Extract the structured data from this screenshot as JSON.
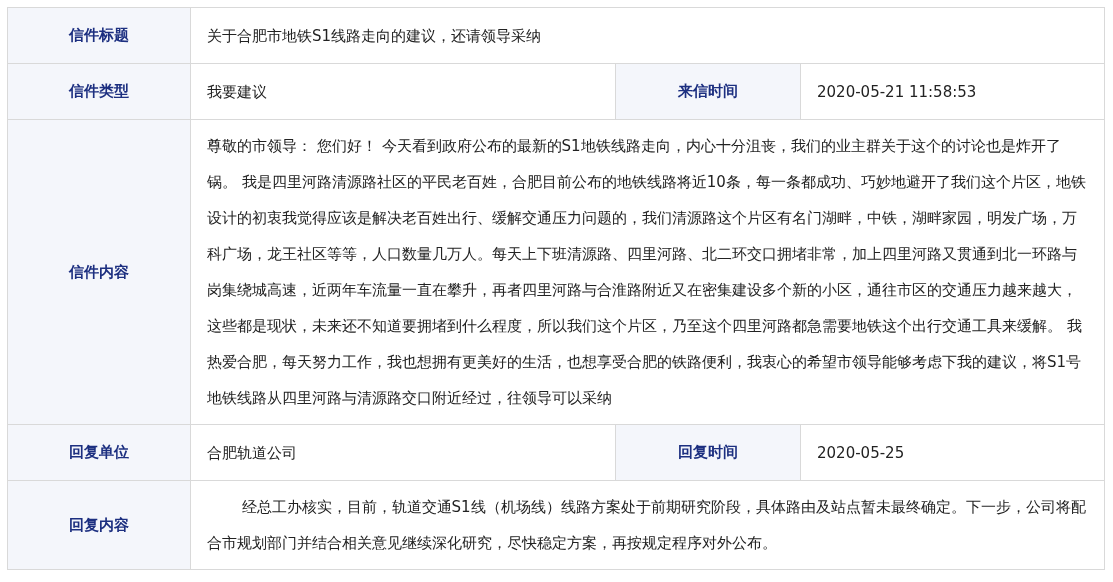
{
  "rows": [
    {
      "cells": [
        {
          "kind": "label",
          "text": "信件标题"
        },
        {
          "kind": "value",
          "text": "关于合肥市地铁S1线路走向的建议，还请领导采纳"
        }
      ]
    },
    {
      "cells": [
        {
          "kind": "label",
          "text": "信件类型"
        },
        {
          "kind": "value",
          "text": "我要建议"
        },
        {
          "kind": "label",
          "text": "来信时间"
        },
        {
          "kind": "value",
          "text": "2020-05-21 11:58:53"
        }
      ]
    },
    {
      "cells": [
        {
          "kind": "label",
          "text": "信件内容"
        },
        {
          "kind": "value",
          "text": "尊敬的市领导： 您们好！ 今天看到政府公布的最新的S1地铁线路走向，内心十分沮丧，我们的业主群关于这个的讨论也是炸开了锅。 我是四里河路清源路社区的平民老百姓，合肥目前公布的地铁线路将近10条，每一条都成功、巧妙地避开了我们这个片区，地铁设计的初衷我觉得应该是解决老百姓出行、缓解交通压力问题的，我们清源路这个片区有名门湖畔，中铁，湖畔家园，明发广场，万科广场，龙王社区等等，人口数量几万人。每天上下班清源路、四里河路、北二环交口拥堵非常，加上四里河路又贯通到北一环路与岗集绕城高速，近两年车流量一直在攀升，再者四里河路与合淮路附近又在密集建设多个新的小区，通往市区的交通压力越来越大，这些都是现状，未来还不知道要拥堵到什么程度，所以我们这个片区，乃至这个四里河路都急需要地铁这个出行交通工具来缓解。 我热爱合肥，每天努力工作，我也想拥有更美好的生活，也想享受合肥的铁路便利，我衷心的希望市领导能够考虑下我的建议，将S1号地铁线路从四里河路与清源路交口附近经过，往领导可以采纳"
        }
      ]
    },
    {
      "cells": [
        {
          "kind": "label",
          "text": "回复单位"
        },
        {
          "kind": "value",
          "text": "合肥轨道公司"
        },
        {
          "kind": "label",
          "text": "回复时间"
        },
        {
          "kind": "value",
          "text": "2020-05-25"
        }
      ]
    },
    {
      "cells": [
        {
          "kind": "label",
          "text": "回复内容"
        },
        {
          "kind": "value",
          "indented": true,
          "text": "经总工办核实，目前，轨道交通S1线（机场线）线路方案处于前期研究阶段，具体路由及站点暂未最终确定。下一步，公司将配合市规划部门并结合相关意见继续深化研究，尽快稳定方案，再按规定程序对外公布。"
        }
      ]
    }
  ]
}
